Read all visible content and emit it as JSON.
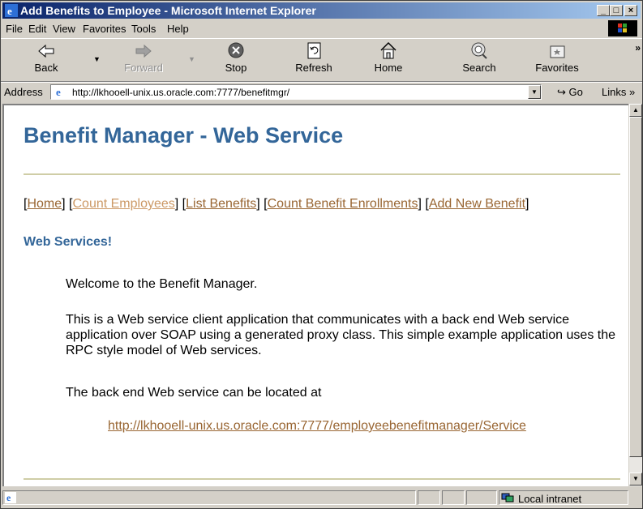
{
  "window": {
    "title": "Add Benefits to Employee - Microsoft Internet Explorer",
    "controls": [
      "_",
      "□",
      "×"
    ]
  },
  "menu": [
    "File",
    "Edit",
    "View",
    "Favorites",
    "Tools",
    "Help"
  ],
  "toolbar": {
    "back": "Back",
    "forward": "Forward",
    "stop": "Stop",
    "refresh": "Refresh",
    "home": "Home",
    "search": "Search",
    "favorites": "Favorites",
    "overflow": "»"
  },
  "address": {
    "label": "Address",
    "url": "http://lkhooell-unix.us.oracle.com:7777/benefitmgr/",
    "go": "Go",
    "links": "Links »"
  },
  "page": {
    "title": "Benefit Manager - Web Service",
    "nav": [
      {
        "label": "Home"
      },
      {
        "label": "Count Employees"
      },
      {
        "label": "List Benefits"
      },
      {
        "label": "Count Benefit Enrollments"
      },
      {
        "label": "Add New Benefit"
      }
    ],
    "section_title": "Web Services!",
    "welcome": "Welcome to the Benefit Manager.",
    "description": "This is a Web service client application that communicates with a back end Web service application over SOAP using a generated proxy class. This simple example application uses the RPC style model of Web services.",
    "located_at": "The back end Web service can be located at",
    "service_url": "http://lkhooell-unix.us.oracle.com:7777/employeebenefitmanager/Service"
  },
  "status": {
    "zone": "Local intranet"
  },
  "colors": {
    "heading": "#336699",
    "link": "#996633",
    "rule": "#cfcda6",
    "titlebar_start": "#0a246a",
    "titlebar_end": "#a6caf0"
  }
}
